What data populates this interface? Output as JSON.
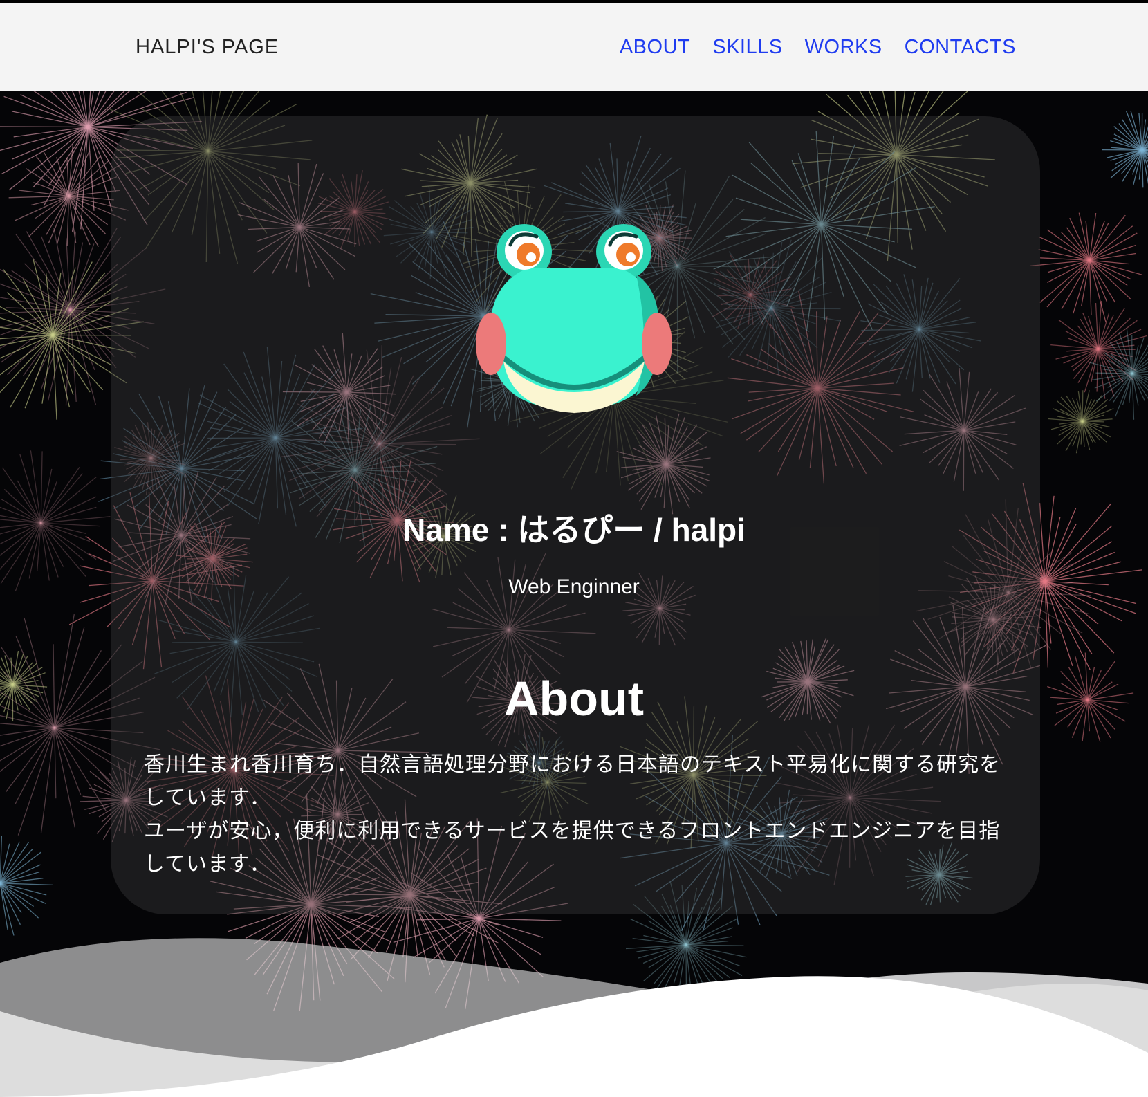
{
  "site": {
    "brand": "HALPI'S PAGE"
  },
  "nav": {
    "items": [
      {
        "label": "ABOUT"
      },
      {
        "label": "SKILLS"
      },
      {
        "label": "WORKS"
      },
      {
        "label": "CONTACTS"
      }
    ]
  },
  "profile": {
    "name": "Name : はるぴー / halpi",
    "role": "Web Enginner"
  },
  "about": {
    "title": "About",
    "paragraph1": "香川生まれ香川育ち．自然言語処理分野における日本語のテキスト平易化に関する研究をしています．",
    "paragraph2": "ユーザが安心，便利に利用できるサービスを提供できるフロントエンドエンジニアを目指しています．"
  },
  "colors": {
    "nav_link": "#1f3cf0",
    "navbar_bg": "#f4f4f4",
    "hero_bg": "#050507",
    "frog_body": "#3af2cf",
    "frog_cheek": "#ec7a7a",
    "frog_belly": "#fbf6d2"
  },
  "icons": {
    "avatar": "frog-avatar-icon"
  }
}
